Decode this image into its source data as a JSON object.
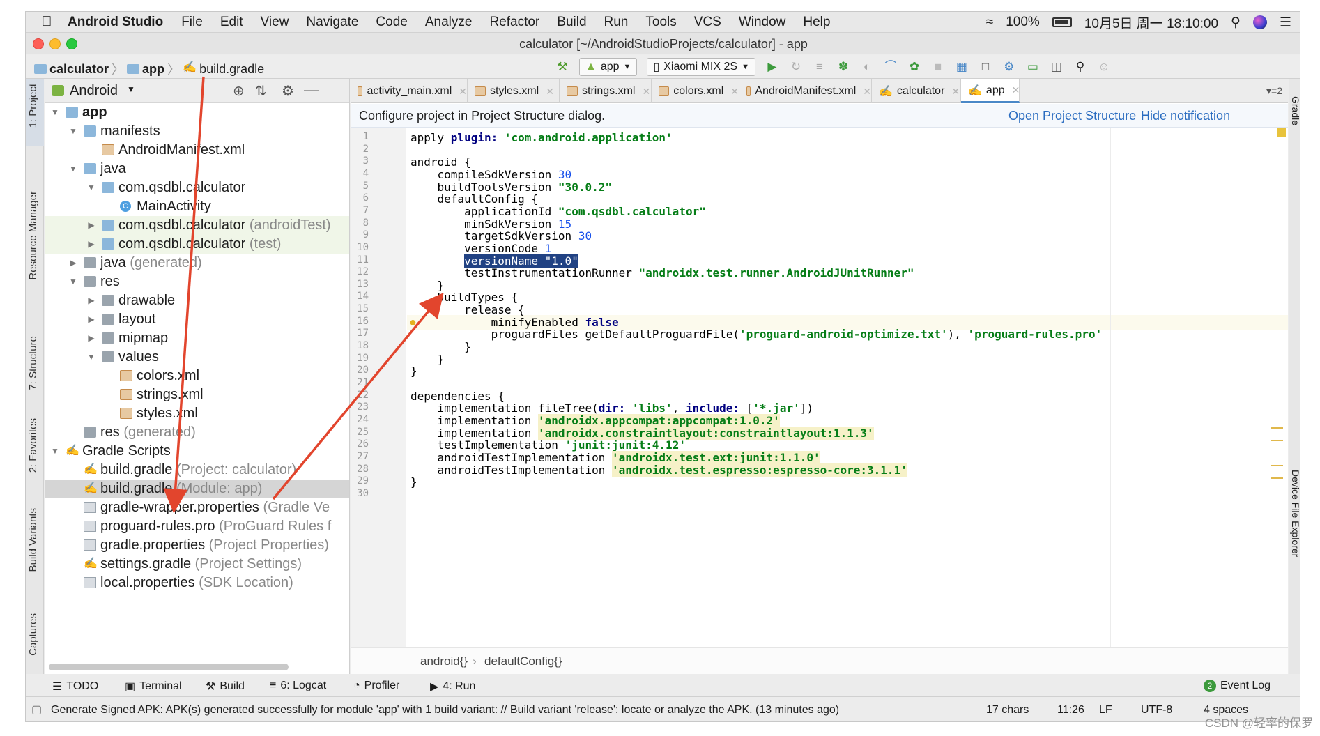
{
  "menubar": {
    "app_name": "Android Studio",
    "items": [
      "File",
      "Edit",
      "View",
      "Navigate",
      "Code",
      "Analyze",
      "Refactor",
      "Build",
      "Run",
      "Tools",
      "VCS",
      "Window",
      "Help"
    ],
    "battery": "100%",
    "datetime": "10月5日 周一  18:10:00"
  },
  "window": {
    "title": "calculator [~/AndroidStudioProjects/calculator] - app"
  },
  "navbar": {
    "crumbs": [
      "calculator",
      "app",
      "build.gradle"
    ],
    "config_dropdown": "app",
    "device_dropdown": "Xiaomi MIX 2S"
  },
  "left_stripe": {
    "tabs": [
      "1: Project",
      "Resource Manager",
      "7: Structure",
      "2: Favorites",
      "Build Variants",
      "Captures"
    ]
  },
  "project_panel": {
    "view_mode": "Android",
    "tree": [
      {
        "label": "app",
        "extra": "",
        "depth": 0,
        "kind": "module",
        "expanded": true
      },
      {
        "label": "manifests",
        "extra": "",
        "depth": 1,
        "kind": "folder",
        "expanded": true
      },
      {
        "label": "AndroidManifest.xml",
        "extra": "",
        "depth": 2,
        "kind": "manifest",
        "leaf": true
      },
      {
        "label": "java",
        "extra": "",
        "depth": 1,
        "kind": "folder",
        "expanded": true
      },
      {
        "label": "com.qsdbl.calculator",
        "extra": "",
        "depth": 2,
        "kind": "package",
        "expanded": true
      },
      {
        "label": "MainActivity",
        "extra": "",
        "depth": 3,
        "kind": "class",
        "leaf": true
      },
      {
        "label": "com.qsdbl.calculator",
        "extra": "(androidTest)",
        "depth": 2,
        "kind": "package",
        "expanded": false,
        "tint": true
      },
      {
        "label": "com.qsdbl.calculator",
        "extra": "(test)",
        "depth": 2,
        "kind": "package",
        "expanded": false,
        "tint": true
      },
      {
        "label": "java",
        "extra": "(generated)",
        "depth": 1,
        "kind": "folder-gen",
        "expanded": false
      },
      {
        "label": "res",
        "extra": "",
        "depth": 1,
        "kind": "folder-res",
        "expanded": true
      },
      {
        "label": "drawable",
        "extra": "",
        "depth": 2,
        "kind": "folder-gray",
        "expanded": false
      },
      {
        "label": "layout",
        "extra": "",
        "depth": 2,
        "kind": "folder-gray",
        "expanded": false
      },
      {
        "label": "mipmap",
        "extra": "",
        "depth": 2,
        "kind": "folder-gray",
        "expanded": false
      },
      {
        "label": "values",
        "extra": "",
        "depth": 2,
        "kind": "folder-gray",
        "expanded": true
      },
      {
        "label": "colors.xml",
        "extra": "",
        "depth": 3,
        "kind": "xml",
        "leaf": true
      },
      {
        "label": "strings.xml",
        "extra": "",
        "depth": 3,
        "kind": "xml",
        "leaf": true
      },
      {
        "label": "styles.xml",
        "extra": "",
        "depth": 3,
        "kind": "xml",
        "leaf": true
      },
      {
        "label": "res",
        "extra": "(generated)",
        "depth": 1,
        "kind": "folder-gray",
        "leaf": true
      },
      {
        "label": "Gradle Scripts",
        "extra": "",
        "depth": 0,
        "kind": "gradle",
        "expanded": true
      },
      {
        "label": "build.gradle",
        "extra": "(Project: calculator)",
        "depth": 1,
        "kind": "gradle",
        "leaf": true
      },
      {
        "label": "build.gradle",
        "extra": "(Module: app)",
        "depth": 1,
        "kind": "gradle",
        "leaf": true,
        "selected": true
      },
      {
        "label": "gradle-wrapper.properties",
        "extra": "(Gradle Ve",
        "depth": 1,
        "kind": "props",
        "leaf": true
      },
      {
        "label": "proguard-rules.pro",
        "extra": "(ProGuard Rules f",
        "depth": 1,
        "kind": "props",
        "leaf": true
      },
      {
        "label": "gradle.properties",
        "extra": "(Project Properties)",
        "depth": 1,
        "kind": "props",
        "leaf": true
      },
      {
        "label": "settings.gradle",
        "extra": "(Project Settings)",
        "depth": 1,
        "kind": "gradle",
        "leaf": true
      },
      {
        "label": "local.properties",
        "extra": "(SDK Location)",
        "depth": 1,
        "kind": "props",
        "leaf": true
      }
    ]
  },
  "editor": {
    "tabs": [
      {
        "label": "activity_main.xml",
        "icon": "xml-file-icon"
      },
      {
        "label": "styles.xml",
        "icon": "xml-file-icon"
      },
      {
        "label": "strings.xml",
        "icon": "xml-file-icon"
      },
      {
        "label": "colors.xml",
        "icon": "xml-file-icon"
      },
      {
        "label": "AndroidManifest.xml",
        "icon": "manifest-file-icon"
      },
      {
        "label": "calculator",
        "icon": "gradle-icon"
      },
      {
        "label": "app",
        "icon": "gradle-icon",
        "active": true
      }
    ],
    "tabs_overflow": "2",
    "notification": {
      "text": "Configure project in Project Structure dialog.",
      "action_open": "Open Project Structure",
      "action_hide": "Hide notification"
    },
    "lines": [
      [
        [
          "apply ",
          ""
        ],
        [
          "plugin:",
          "kw"
        ],
        [
          " ",
          ""
        ],
        [
          "'com.android.application'",
          "str"
        ]
      ],
      [],
      [
        [
          "android {",
          ""
        ]
      ],
      [
        [
          "    compileSdkVersion ",
          ""
        ],
        [
          "30",
          "num"
        ]
      ],
      [
        [
          "    buildToolsVersion ",
          ""
        ],
        [
          "\"30.0.2\"",
          "str"
        ]
      ],
      [
        [
          "    defaultConfig {",
          ""
        ]
      ],
      [
        [
          "        applicationId ",
          ""
        ],
        [
          "\"com.qsdbl.calculator\"",
          "str"
        ]
      ],
      [
        [
          "        minSdkVersion ",
          ""
        ],
        [
          "15",
          "num"
        ]
      ],
      [
        [
          "        targetSdkVersion ",
          ""
        ],
        [
          "30",
          "num"
        ]
      ],
      [
        [
          "        versionCode ",
          ""
        ],
        [
          "1",
          "num"
        ]
      ],
      [
        [
          "        ",
          ""
        ],
        [
          "versionName \"1.0\"",
          "sel"
        ]
      ],
      [
        [
          "        testInstrumentationRunner ",
          ""
        ],
        [
          "\"androidx.test.runner.AndroidJUnitRunner\"",
          "str"
        ]
      ],
      [
        [
          "    }",
          ""
        ]
      ],
      [
        [
          "    buildTypes {",
          ""
        ]
      ],
      [
        [
          "        release {",
          ""
        ]
      ],
      [
        [
          "            minifyEnabled ",
          ""
        ],
        [
          "false",
          "kw"
        ]
      ],
      [
        [
          "            proguardFiles getDefaultProguardFile(",
          ""
        ],
        [
          "'proguard-android-optimize.txt'",
          "str"
        ],
        [
          "), ",
          ""
        ],
        [
          "'proguard-rules.pro'",
          "str"
        ]
      ],
      [
        [
          "        }",
          ""
        ]
      ],
      [
        [
          "    }",
          ""
        ]
      ],
      [
        [
          "}",
          ""
        ]
      ],
      [],
      [
        [
          "dependencies {",
          ""
        ]
      ],
      [
        [
          "    implementation fileTree(",
          ""
        ],
        [
          "dir:",
          "kw"
        ],
        [
          " ",
          ""
        ],
        [
          "'libs'",
          "str"
        ],
        [
          ", ",
          ""
        ],
        [
          "include:",
          "kw"
        ],
        [
          " [",
          ""
        ],
        [
          "'*.jar'",
          "str"
        ],
        [
          "])",
          ""
        ]
      ],
      [
        [
          "    implementation ",
          ""
        ],
        [
          "'androidx.appcompat:appcompat:1.0.2'",
          "strhl"
        ]
      ],
      [
        [
          "    implementation ",
          ""
        ],
        [
          "'androidx.constraintlayout:constraintlayout:1.1.3'",
          "strhl"
        ]
      ],
      [
        [
          "    testImplementation ",
          ""
        ],
        [
          "'junit:junit:4.12'",
          "str"
        ]
      ],
      [
        [
          "    androidTestImplementation ",
          ""
        ],
        [
          "'androidx.test.ext:junit:1.1.0'",
          "strhl"
        ]
      ],
      [
        [
          "    androidTestImplementation ",
          ""
        ],
        [
          "'androidx.test.espresso:espresso-core:3.1.1'",
          "strhl"
        ]
      ],
      [
        [
          "}",
          ""
        ]
      ],
      []
    ],
    "breadcrumb": [
      "android{}",
      "defaultConfig{}"
    ]
  },
  "right_stripe": {
    "tabs": [
      "Gradle",
      "Device File Explorer"
    ]
  },
  "bottom_tools": [
    {
      "label": "TODO",
      "icon": "list-icon"
    },
    {
      "label": "Terminal",
      "icon": "terminal-icon"
    },
    {
      "label": "Build",
      "icon": "hammer-icon"
    },
    {
      "label": "6: Logcat",
      "icon": "logcat-icon"
    },
    {
      "label": "Profiler",
      "icon": "profiler-icon"
    },
    {
      "label": "4: Run",
      "icon": "run-icon"
    }
  ],
  "event_log": {
    "label": "Event Log",
    "count": "2"
  },
  "statusbar": {
    "message": "Generate Signed APK: APK(s) generated successfully for module 'app' with 1 build variant: // Build variant 'release': locate or analyze the APK. (13 minutes ago)",
    "chars": "17 chars",
    "position": "11:26",
    "line_sep": "LF",
    "encoding": "UTF-8",
    "indent": "4 spaces"
  },
  "watermark": "CSDN @轻率的保罗",
  "colors": {
    "accent": "#4a88c7",
    "annotation_arrow": "#e2452d",
    "selection": "#214283"
  }
}
